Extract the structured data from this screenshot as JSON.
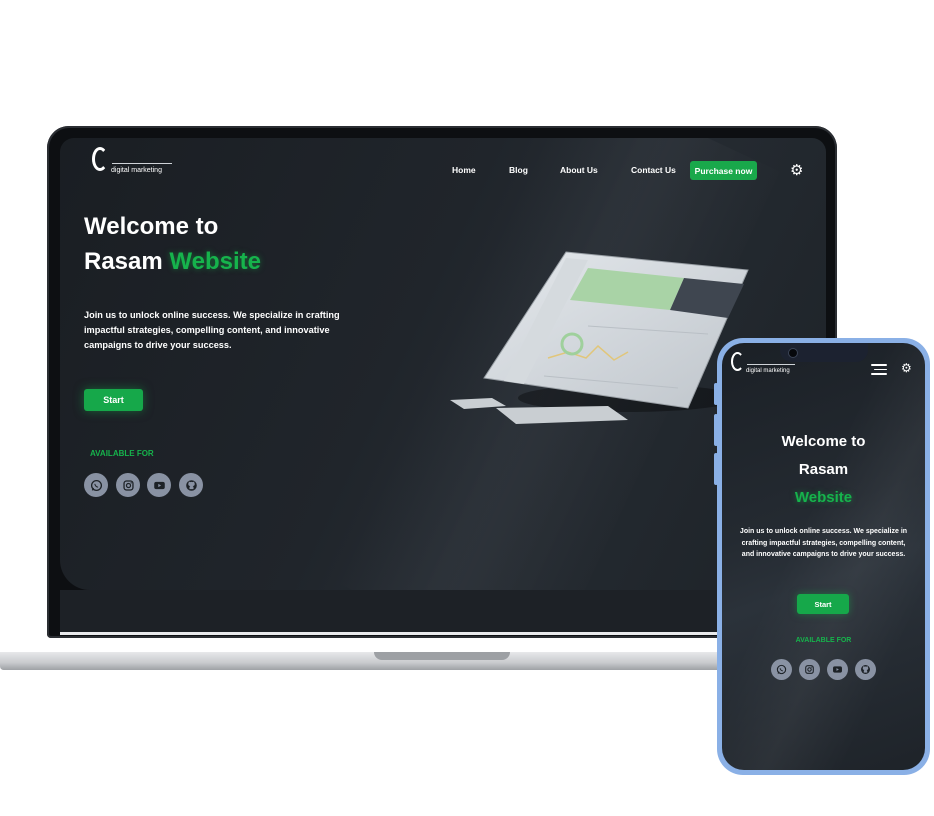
{
  "brand": {
    "logo_text": "digital marketing"
  },
  "nav": {
    "home": "Home",
    "blog": "Blog",
    "about": "About Us",
    "contact": "Contact Us",
    "purchase": "Purchase now"
  },
  "hero": {
    "title_line1": "Welcome to",
    "title_line2": "Rasam",
    "title_highlight": "Website",
    "description": "Join us to unlock online success. We specialize in crafting impactful strategies, compelling content, and innovative campaigns to drive your success.",
    "start_label": "Start",
    "available_label": "AVAILABLE FOR"
  },
  "social_icons": [
    "whatsapp-icon",
    "instagram-icon",
    "youtube-icon",
    "github-icon"
  ],
  "colors": {
    "accent": "#16b34c",
    "button": "#16a84a",
    "background": "#1d2227",
    "phone_frame": "#8ab0e6",
    "social_bg": "#8992a3"
  }
}
